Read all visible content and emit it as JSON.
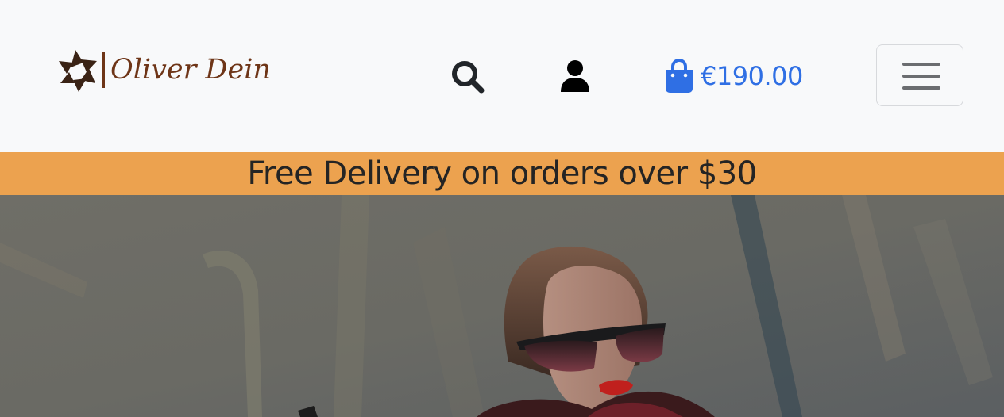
{
  "header": {
    "brand": {
      "name": "Oliver Dein",
      "logo_icon": "star-knot-logo-icon",
      "color": "#6e3517"
    },
    "icons": {
      "search": "search-icon",
      "account": "user-icon",
      "cart": "shopping-bag-icon",
      "menu": "hamburger-menu-icon"
    },
    "cart": {
      "total": "€190.00",
      "color": "#2f6fe4"
    }
  },
  "banner": {
    "text": "Free Delivery on orders over $30",
    "background": "#eca24f"
  },
  "hero": {
    "image": "woman-with-sunglasses-hero-image"
  }
}
